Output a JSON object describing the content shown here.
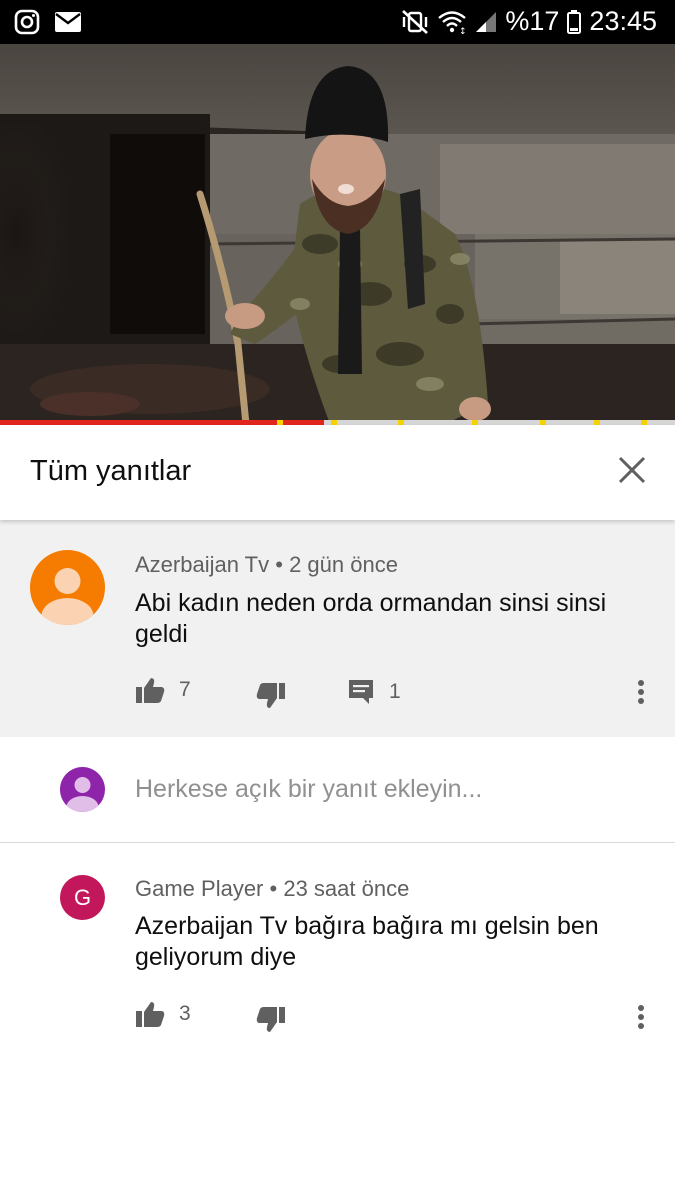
{
  "status_bar": {
    "battery_text": "%17",
    "time": "23:45",
    "icons": [
      "instagram-icon",
      "mail-icon",
      "mute-vibrate-icon",
      "wifi-icon",
      "signal-icon",
      "battery-icon"
    ]
  },
  "video": {
    "progress_fraction": 0.48,
    "ad_markers": [
      0.41,
      0.49,
      0.59,
      0.7,
      0.8,
      0.88,
      0.95
    ]
  },
  "header": {
    "title": "Tüm yanıtlar",
    "close_icon": "close-icon"
  },
  "parent_comment": {
    "author": "Azerbaijan Tv",
    "separator": "•",
    "time": "2 gün önce",
    "text": "Abi kadın neden orda ormandan sinsi sinsi geldi",
    "likes": "7",
    "replies": "1",
    "avatar_color": "#f57c00"
  },
  "reply_box": {
    "placeholder": "Herkese açık bir yanıt ekleyin...",
    "avatar_color": "#8e24aa"
  },
  "replies": [
    {
      "avatar_letter": "G",
      "avatar_color": "#c2185b",
      "author": "Game Player",
      "separator": "•",
      "time": "23 saat önce",
      "text": "Azerbaijan Tv bağıra bağıra mı gelsin ben geliyorum diye",
      "likes": "3"
    }
  ],
  "colors": {
    "progress": "#e0261d",
    "ad_marker": "#f6d300",
    "meta_text": "#606060",
    "parent_bg": "#f1f1f1"
  }
}
